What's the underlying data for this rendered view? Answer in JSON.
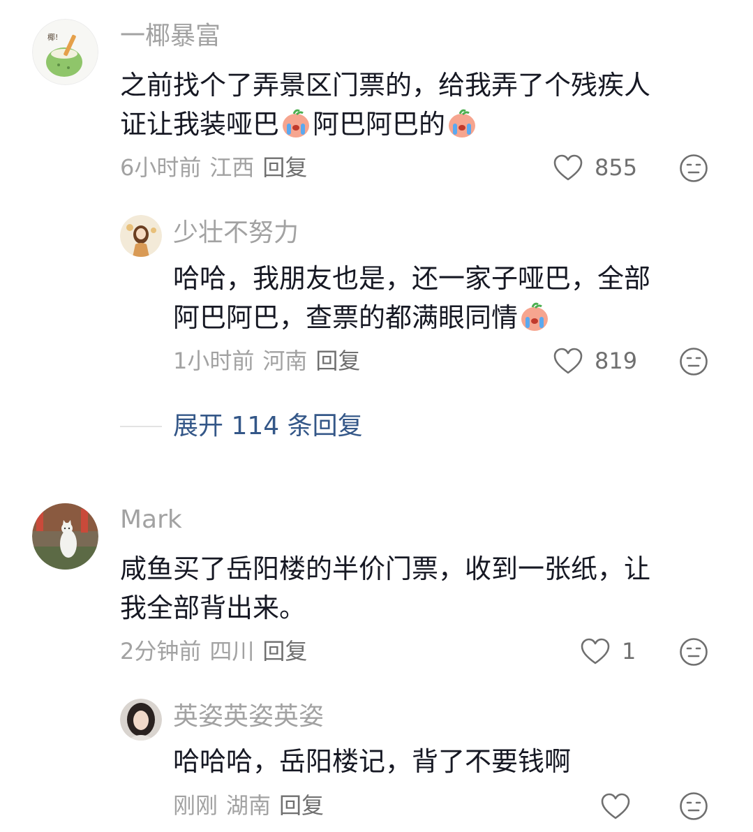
{
  "threads": [
    {
      "username": "一椰暴富",
      "content_line1": "之前找个了弄景区门票的，给我弄了个残疾人",
      "content_line2_a": "证让我装哑巴",
      "content_line2_b": "阿巴阿巴的",
      "time": "6小时前",
      "location": "江西",
      "reply_label": "回复",
      "likes": "855",
      "avatar_badge": "椰!",
      "replies": [
        {
          "username": "少壮不努力",
          "content_line1": "哈哈，我朋友也是，还一家子哑巴，全部",
          "content_line2": "阿巴阿巴，查票的都满眼同情",
          "time": "1小时前",
          "location": "河南",
          "reply_label": "回复",
          "likes": "819"
        }
      ],
      "expand_label": "展开 114 条回复"
    },
    {
      "username": "Mark",
      "content_line1": "咸鱼买了岳阳楼的半价门票，收到一张纸，让",
      "content_line2": "我全部背出来。",
      "time": "2分钟前",
      "location": "四川",
      "reply_label": "回复",
      "likes": "1",
      "replies": [
        {
          "username": "英姿英姿英姿",
          "content_line1": "哈哈哈，岳阳楼记，背了不要钱啊",
          "time": "刚刚",
          "location": "湖南",
          "reply_label": "回复",
          "likes": ""
        }
      ]
    }
  ],
  "icons": {
    "like": "heart-outline-icon",
    "dislike": "meh-face-icon",
    "emoji": "crying-peach-emoji"
  },
  "colors": {
    "username": "#a2a2a2",
    "content": "#161823",
    "meta": "#a2a2a2",
    "expand_link": "#345788",
    "divider": "#e3e3e3"
  }
}
